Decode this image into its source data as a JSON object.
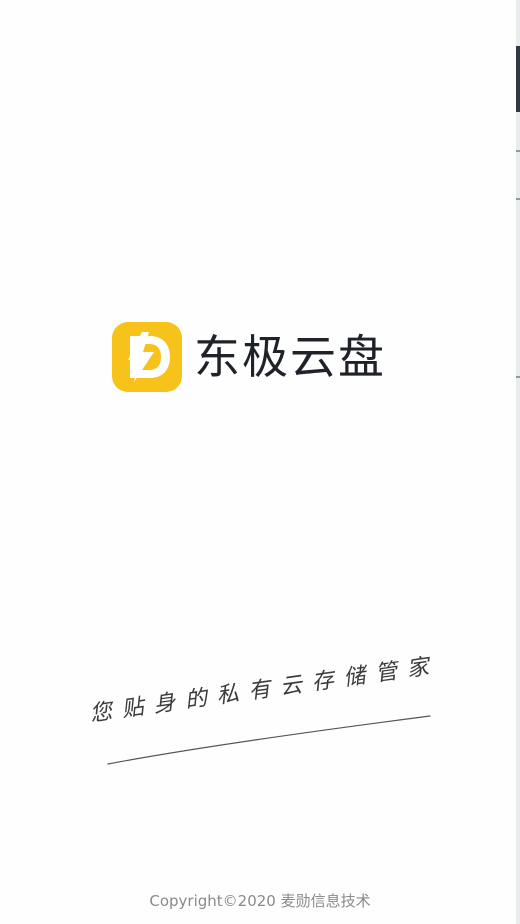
{
  "splash": {
    "app_name": "东极云盘",
    "slogan": "您贴身的私有云存储管家",
    "copyright": "Copyright©2020 麦勋信息技术"
  },
  "brand": {
    "icon": "lightning-d-logo-icon",
    "accent_color": "#F7C21A",
    "text_color": "#1F2329"
  }
}
